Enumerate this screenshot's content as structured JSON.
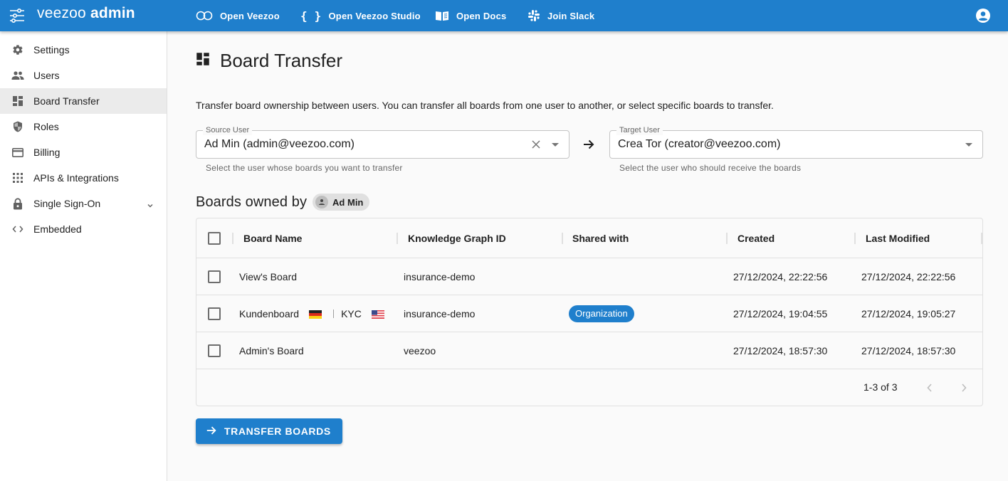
{
  "topbar": {
    "brand_light": "veezoo",
    "brand_bold": "admin",
    "links": [
      {
        "label": "Open Veezoo",
        "icon": "infinity-icon"
      },
      {
        "label": "Open Veezoo Studio",
        "icon": "braces-icon"
      },
      {
        "label": "Open Docs",
        "icon": "book-icon"
      },
      {
        "label": "Join Slack",
        "icon": "slack-icon"
      }
    ],
    "account_icon": "account-circle-icon",
    "color": "#1f7fcc"
  },
  "sidebar": {
    "items": [
      {
        "label": "Settings",
        "icon": "gear-icon"
      },
      {
        "label": "Users",
        "icon": "users-icon"
      },
      {
        "label": "Board Transfer",
        "icon": "dashboard-icon",
        "active": true
      },
      {
        "label": "Roles",
        "icon": "shield-icon"
      },
      {
        "label": "Billing",
        "icon": "credit-card-icon"
      },
      {
        "label": "APIs & Integrations",
        "icon": "apps-grid-icon"
      },
      {
        "label": "Single Sign-On",
        "icon": "lock-icon",
        "expandable": true
      },
      {
        "label": "Embedded",
        "icon": "code-icon"
      }
    ]
  },
  "main": {
    "title": "Board Transfer",
    "description": "Transfer board ownership between users. You can transfer all boards from one user to another, or select specific boards to transfer.",
    "source": {
      "label": "Source User",
      "value": "Ad Min (admin@veezoo.com)",
      "helper": "Select the user whose boards you want to transfer"
    },
    "target": {
      "label": "Target User",
      "value": "Crea Tor (creator@veezoo.com)",
      "helper": "Select the user who should receive the boards"
    },
    "owned_heading": "Boards owned by",
    "owner_chip": "Ad Min",
    "table": {
      "columns": [
        "Board Name",
        "Knowledge Graph ID",
        "Shared with",
        "Created",
        "Last Modified"
      ],
      "rows": [
        {
          "name": "View's Board",
          "kg": "insurance-demo",
          "shared": "",
          "created": "27/12/2024, 22:22:56",
          "modified": "27/12/2024, 22:22:56"
        },
        {
          "name": "Kundenboard",
          "name_suffix": "KYC",
          "flags": [
            "de",
            "us"
          ],
          "kg": "insurance-demo",
          "shared": "Organization",
          "created": "27/12/2024, 19:04:55",
          "modified": "27/12/2024, 19:05:27"
        },
        {
          "name": "Admin's Board",
          "kg": "veezoo",
          "shared": "",
          "created": "27/12/2024, 18:57:30",
          "modified": "27/12/2024, 18:57:30"
        }
      ],
      "pagination": "1-3 of 3"
    },
    "transfer_button": "TRANSFER BOARDS"
  }
}
